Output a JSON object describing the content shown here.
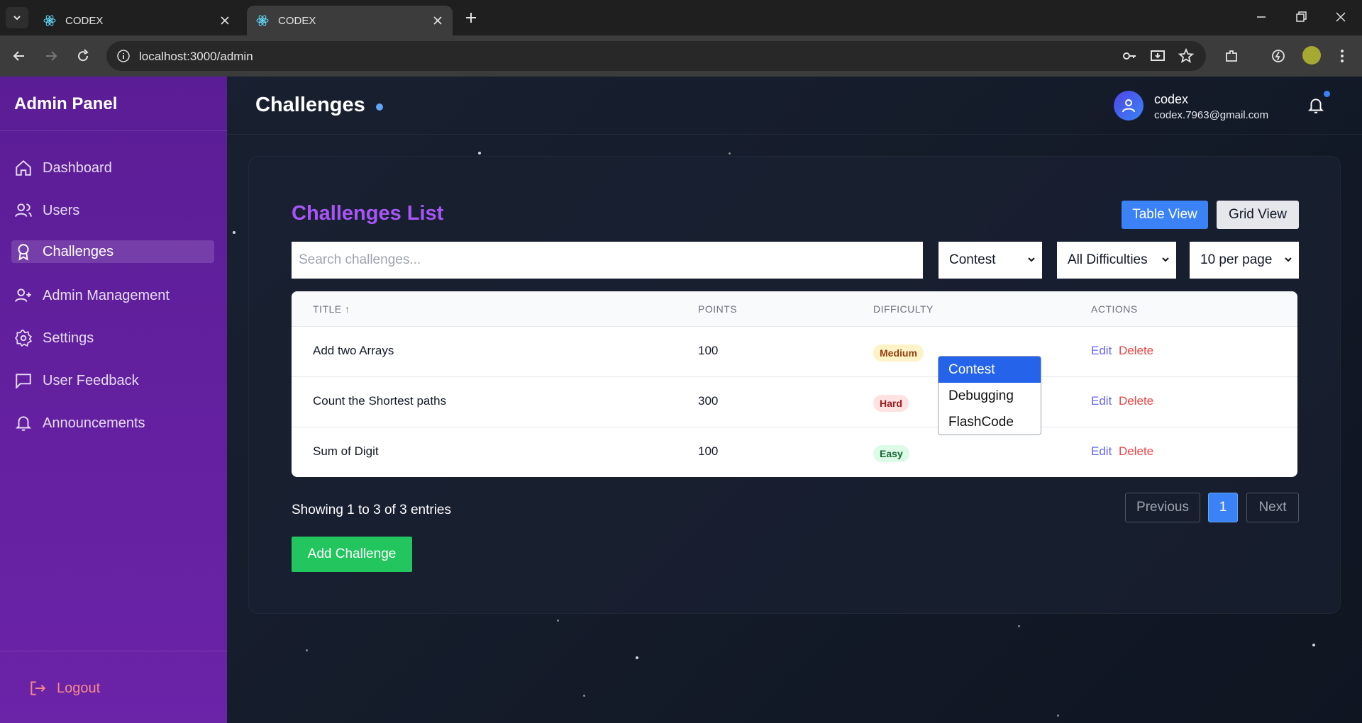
{
  "browser": {
    "tabs": [
      {
        "title": "CODEX",
        "active": false
      },
      {
        "title": "CODEX",
        "active": true
      }
    ],
    "url": "localhost:3000/admin"
  },
  "sidebar": {
    "brand": "Admin Panel",
    "items": [
      {
        "label": "Dashboard",
        "icon": "home-icon",
        "active": false
      },
      {
        "label": "Users",
        "icon": "users-icon",
        "active": false
      },
      {
        "label": "Challenges",
        "icon": "award-icon",
        "active": true
      },
      {
        "label": "Admin Management",
        "icon": "user-plus-icon",
        "active": false
      },
      {
        "label": "Settings",
        "icon": "gear-icon",
        "active": false
      },
      {
        "label": "User Feedback",
        "icon": "message-icon",
        "active": false
      },
      {
        "label": "Announcements",
        "icon": "bell-icon",
        "active": false
      }
    ],
    "logout": "Logout"
  },
  "header": {
    "title": "Challenges",
    "user_name": "codex",
    "user_email": "codex.7963@gmail.com"
  },
  "main": {
    "list_title": "Challenges List",
    "table_view_label": "Table View",
    "grid_view_label": "Grid View",
    "search_placeholder": "Search challenges...",
    "category_select": "Contest",
    "difficulty_select": "All Difficulties",
    "per_page_select": "10 per page",
    "category_options": [
      "Contest",
      "Debugging",
      "FlashCode"
    ],
    "columns": [
      "TITLE ↑",
      "POINTS",
      "DIFFICULTY",
      "ACTIONS"
    ],
    "rows": [
      {
        "title": "Add two Arrays",
        "points": "100",
        "difficulty": "Medium"
      },
      {
        "title": "Count the Shortest paths",
        "points": "300",
        "difficulty": "Hard"
      },
      {
        "title": "Sum of Digit",
        "points": "100",
        "difficulty": "Easy"
      }
    ],
    "edit_label": "Edit",
    "delete_label": "Delete",
    "showing_text": "Showing 1 to 3 of 3 entries",
    "pagination": {
      "previous": "Previous",
      "current": "1",
      "next": "Next"
    },
    "add_button": "Add Challenge"
  },
  "colors": {
    "sidebar": "#5b1d96",
    "accent_purple": "#a855f7",
    "primary_blue": "#3b82f6",
    "success_green": "#22c55e",
    "danger_red": "#ef4444",
    "medium_badge_bg": "#fef3c7",
    "hard_badge_bg": "#fee2e2",
    "easy_badge_bg": "#dcfce7"
  }
}
